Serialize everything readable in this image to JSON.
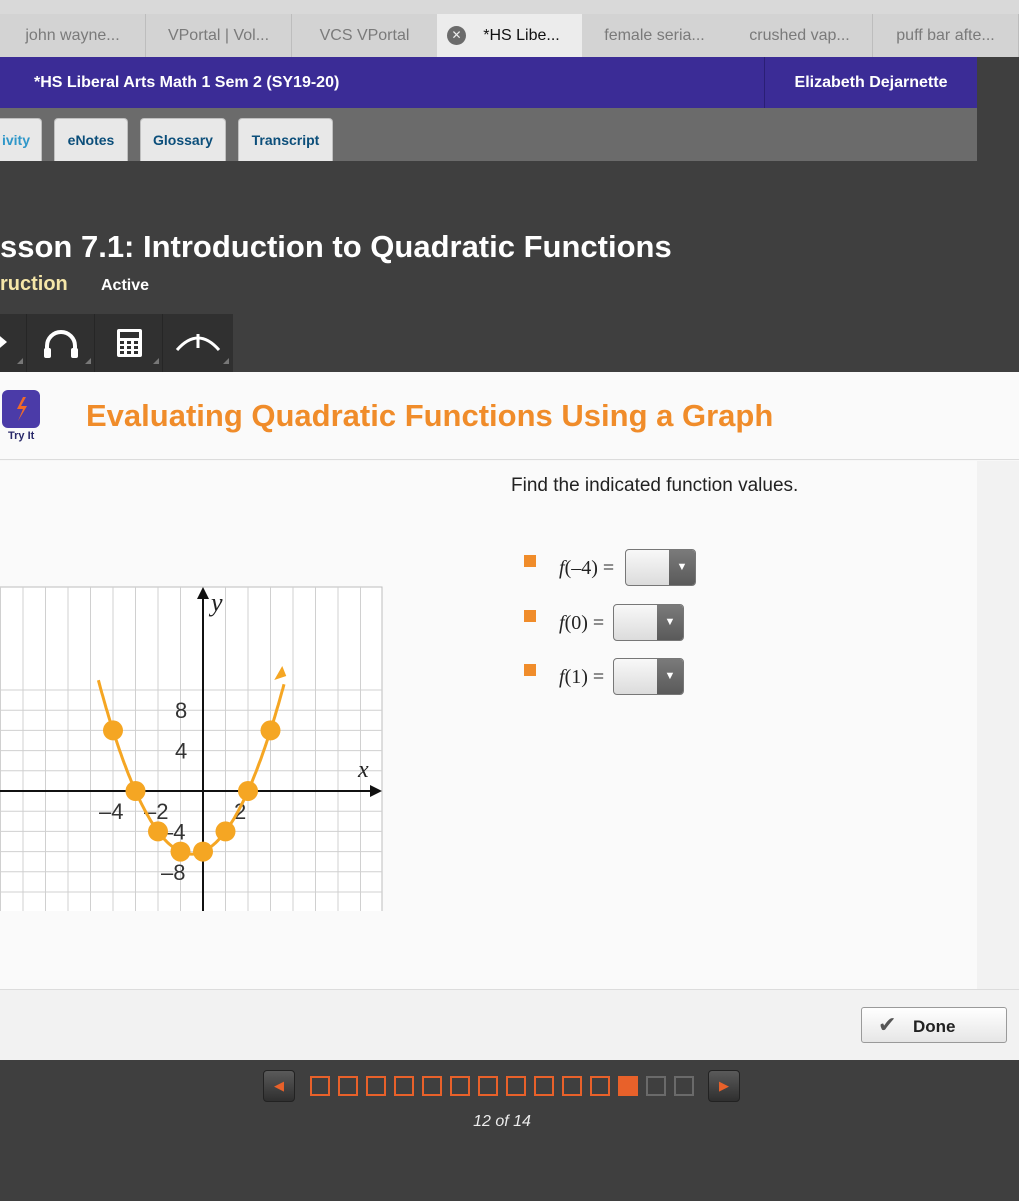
{
  "browser": {
    "tabs": [
      {
        "label": "john wayne...",
        "active": false
      },
      {
        "label": "VPortal | Vol...",
        "active": false
      },
      {
        "label": "VCS VPortal",
        "active": false
      },
      {
        "label": "*HS Libe...",
        "active": true
      },
      {
        "label": "female seria...",
        "active": false
      },
      {
        "label": "crushed vap...",
        "active": false
      },
      {
        "label": "puff bar afte...",
        "active": false
      }
    ]
  },
  "course": {
    "title": "*HS Liberal Arts Math 1 Sem 2 (SY19-20)",
    "user": "Elizabeth Dejarnette",
    "accent": "#3b2c96"
  },
  "nav": {
    "tabs": [
      "ivity",
      "eNotes",
      "Glossary",
      "Transcript"
    ]
  },
  "lesson": {
    "title": "sson 7.1: Introduction to Quadratic Functions",
    "subtitle": "ruction",
    "status": "Active",
    "tools": [
      "pencil-icon",
      "headphones-icon",
      "calculator-icon",
      "collapse-icon"
    ]
  },
  "activity": {
    "badge": "Try It",
    "title": "Evaluating Quadratic Functions Using a Graph",
    "title_color": "#f08c2a",
    "prompt": "Find the indicated function values.",
    "questions": [
      {
        "fn": "f",
        "arg": "(–4) =",
        "value": ""
      },
      {
        "fn": "f",
        "arg": "(0) =",
        "value": ""
      },
      {
        "fn": "f",
        "arg": "(1) =",
        "value": ""
      }
    ],
    "done_label": "Done"
  },
  "chart_data": {
    "type": "scatter",
    "title": "",
    "xlabel": "x",
    "ylabel": "y",
    "xlim": [
      -4.5,
      4
    ],
    "ylim": [
      -10,
      10
    ],
    "x_ticks": [
      {
        "value": -4,
        "label": "–4"
      },
      {
        "value": -2,
        "label": "–2"
      },
      {
        "value": 2,
        "label": "2"
      }
    ],
    "y_ticks": [
      {
        "value": 8,
        "label": "8"
      },
      {
        "value": 4,
        "label": "4"
      },
      {
        "value": -4,
        "label": "–4"
      },
      {
        "value": -8,
        "label": "–8"
      }
    ],
    "grid": true,
    "series": [
      {
        "x": [
          -4,
          -3,
          -2,
          -1,
          0,
          1,
          2,
          3
        ],
        "y": [
          6,
          0,
          -4,
          -6,
          -6,
          -4,
          0,
          6
        ],
        "color": "#f5a623"
      }
    ]
  },
  "pager": {
    "total": 14,
    "current": 12,
    "label": "12 of 14"
  }
}
